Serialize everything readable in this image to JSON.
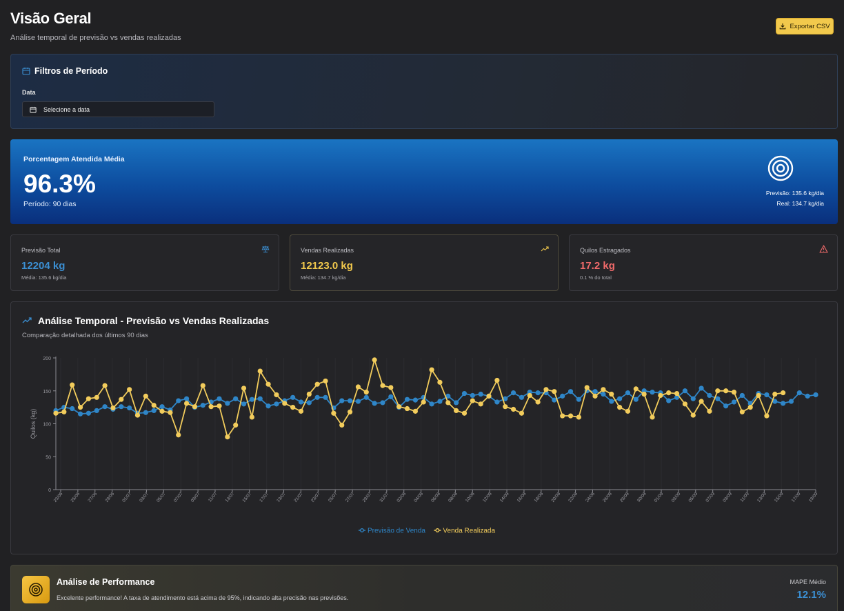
{
  "header": {
    "title": "Visão Geral",
    "subtitle": "Análise temporal de previsão vs vendas realizadas",
    "export_label": "Exportar CSV"
  },
  "filters": {
    "title": "Filtros de Período",
    "date_label": "Data",
    "date_placeholder": "Selecione a data"
  },
  "kpi": {
    "label": "Porcentagem Atendida Média",
    "value": "96.3%",
    "period": "Período: 90 dias",
    "forecast": "Previsão: 135.6 kg/dia",
    "actual": "Real: 134.7 kg/dia"
  },
  "stats": [
    {
      "label": "Previsão Total",
      "value": "12204 kg",
      "sub": "Média: 135.6 kg/dia",
      "color": "#3b8fd3",
      "icon": "scale-icon"
    },
    {
      "label": "Vendas Realizadas",
      "value": "12123.0 kg",
      "sub": "Média: 134.7 kg/dia",
      "color": "#f2c94c",
      "icon": "trending-up-icon"
    },
    {
      "label": "Quilos Estragados",
      "value": "17.2 kg",
      "sub": "0.1 % do total",
      "color": "#f06a6a",
      "icon": "alert-triangle-icon"
    }
  ],
  "chart": {
    "title": "Análise Temporal - Previsão vs Vendas Realizadas",
    "subtitle": "Comparação detalhada dos últimos 90 dias"
  },
  "chart_data": {
    "type": "line",
    "ylabel": "Quilos (kg)",
    "ylim": [
      0,
      200
    ],
    "yticks": [
      0,
      50,
      100,
      150,
      200
    ],
    "xtick_labels": [
      "23/06",
      "25/06",
      "27/06",
      "29/06",
      "01/07",
      "03/07",
      "05/07",
      "07/07",
      "09/07",
      "11/07",
      "13/07",
      "15/07",
      "17/07",
      "19/07",
      "21/07",
      "23/07",
      "25/07",
      "27/07",
      "29/07",
      "31/07",
      "02/08",
      "04/08",
      "06/08",
      "08/08",
      "10/08",
      "12/08",
      "14/08",
      "16/08",
      "18/08",
      "20/08",
      "22/08",
      "24/08",
      "26/08",
      "28/08",
      "30/08",
      "01/09",
      "03/09",
      "05/09",
      "07/09",
      "09/09",
      "11/09",
      "13/09",
      "15/09",
      "17/09",
      "19/09"
    ],
    "legend_position": "bottom-center",
    "series": [
      {
        "name": "Previsão de Venda",
        "color": "#2f86c8",
        "values": [
          120,
          125,
          123,
          115,
          116,
          120,
          126,
          122,
          126,
          124,
          116,
          117,
          120,
          126,
          121,
          135,
          138,
          125,
          128,
          133,
          138,
          131,
          138,
          130,
          137,
          138,
          127,
          130,
          135,
          140,
          133,
          132,
          140,
          140,
          124,
          135,
          135,
          134,
          140,
          131,
          132,
          141,
          125,
          137,
          136,
          140,
          130,
          134,
          142,
          132,
          146,
          143,
          145,
          142,
          133,
          138,
          147,
          140,
          148,
          147,
          147,
          136,
          142,
          149,
          137,
          150,
          149,
          145,
          134,
          138,
          147,
          137,
          150,
          148,
          147,
          135,
          140,
          150,
          138,
          154,
          143,
          138,
          127,
          133,
          143,
          131,
          146,
          144,
          134,
          131,
          134,
          147,
          142,
          144
        ]
      },
      {
        "name": "Venda Realizada",
        "color": "#f2cc5c",
        "values": [
          116,
          118,
          159,
          125,
          138,
          140,
          158,
          124,
          137,
          152,
          113,
          142,
          128,
          119,
          117,
          83,
          131,
          126,
          158,
          126,
          127,
          80,
          98,
          154,
          110,
          180,
          160,
          144,
          131,
          125,
          119,
          145,
          160,
          165,
          116,
          98,
          118,
          156,
          148,
          197,
          158,
          155,
          126,
          123,
          119,
          133,
          182,
          163,
          132,
          120,
          116,
          135,
          130,
          142,
          166,
          126,
          122,
          116,
          143,
          133,
          152,
          149,
          112,
          112,
          110,
          155,
          142,
          152,
          145,
          125,
          119,
          153,
          145,
          110,
          143,
          147,
          146,
          130,
          113,
          134,
          119,
          150,
          150,
          148,
          118,
          125,
          143,
          112,
          145,
          147
        ]
      }
    ]
  },
  "performance": {
    "title": "Análise de Performance",
    "text": "Excelente performance! A taxa de atendimento está acima de 95%, indicando alta precisão nas previsões.",
    "mape_label": "MAPE Médio",
    "mape_value": "12.1%"
  }
}
